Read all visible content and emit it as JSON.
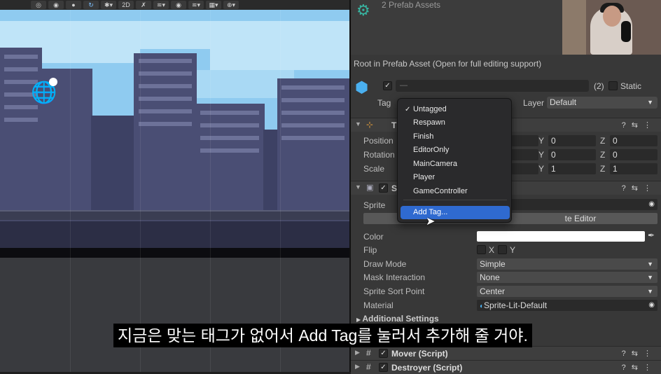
{
  "scene": {
    "toolbar": {
      "mode_2d": "2D"
    }
  },
  "inspector": {
    "prefab_count": "2 Prefab Assets",
    "root_text": "Root in Prefab Asset (Open for full editing support)",
    "header": {
      "name_placeholder": "—",
      "object_count": "(2)",
      "static_label": "Static",
      "tag_label": "Tag",
      "layer_label": "Layer",
      "layer_value": "Default"
    },
    "transform": {
      "title": "T",
      "position_label": "Position",
      "rotation_label": "Rotation",
      "scale_label": "Scale",
      "axis_y": "Y",
      "axis_z": "Z",
      "position": {
        "y": "0",
        "z": "0"
      },
      "rotation": {
        "y": "0",
        "z": "0"
      },
      "scale": {
        "y": "1",
        "z": "1"
      }
    },
    "sprite_renderer": {
      "title": "S",
      "sprite_label": "Sprite",
      "open_editor_label": "te Editor",
      "color_label": "Color",
      "color_value": "#ffffff",
      "flip_label": "Flip",
      "flip_x": "X",
      "flip_y": "Y",
      "draw_mode_label": "Draw Mode",
      "draw_mode_value": "Simple",
      "mask_label": "Mask Interaction",
      "mask_value": "None",
      "sort_point_label": "Sprite Sort Point",
      "sort_point_value": "Center",
      "material_label": "Material",
      "material_value": "Sprite-Lit-Default",
      "additional_settings": "Additional Settings"
    },
    "components": [
      {
        "title": "Mover (Script)"
      },
      {
        "title": "Destroyer (Script)"
      }
    ]
  },
  "tag_menu": {
    "items": [
      "Untagged",
      "Respawn",
      "Finish",
      "EditorOnly",
      "MainCamera",
      "Player",
      "GameController"
    ],
    "checked_item": "Untagged",
    "add_tag": "Add Tag..."
  },
  "subtitle": "지금은 맞는 태그가 없어서 Add Tag를 눌러서 추가해 줄 거야.",
  "colors": {
    "accent_selection": "#2f6ad0",
    "sky": "#8fcbf0",
    "buildings": "#4a4e74"
  }
}
